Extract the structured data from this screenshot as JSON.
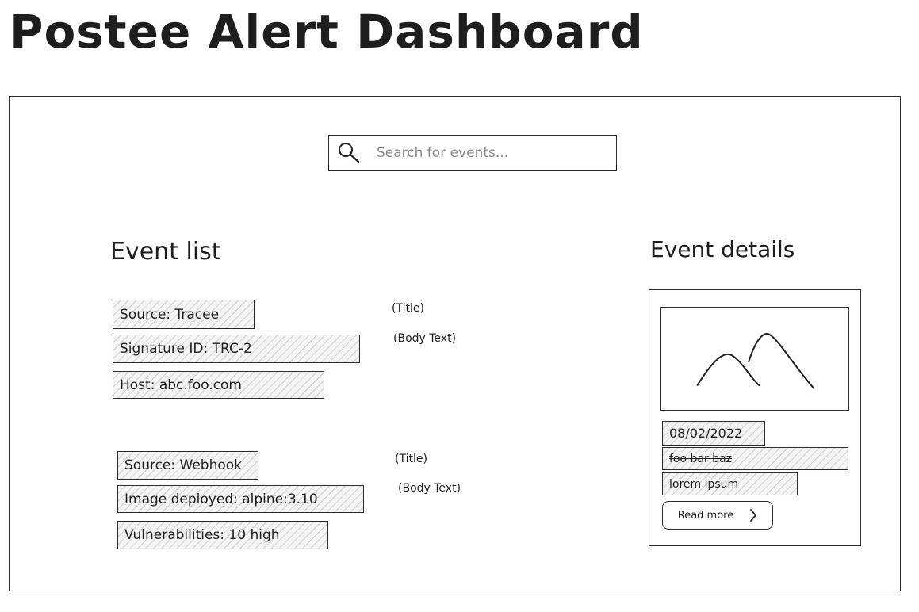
{
  "app": {
    "title": "Postee Alert Dashboard"
  },
  "search": {
    "placeholder": "Search for events..."
  },
  "event_list": {
    "heading": "Event list",
    "events": [
      {
        "source": "Source: Tracee",
        "detail1": "Signature ID: TRC-2",
        "detail2": "Host: abc.foo.com",
        "title_note": "(Title)",
        "body_note": "(Body Text)"
      },
      {
        "source": "Source: Webhook",
        "detail1": "Image deployed: alpine:3.10",
        "detail2": "Vulnerabilities: 10 high",
        "title_note": "(Title)",
        "body_note": "(Body Text)"
      }
    ]
  },
  "event_details": {
    "heading": "Event details",
    "date": "08/02/2022",
    "line1": "foo bar baz",
    "line2": "lorem ipsum",
    "read_more_label": "Read more",
    "image_icon": "mountain-image-icon"
  }
}
